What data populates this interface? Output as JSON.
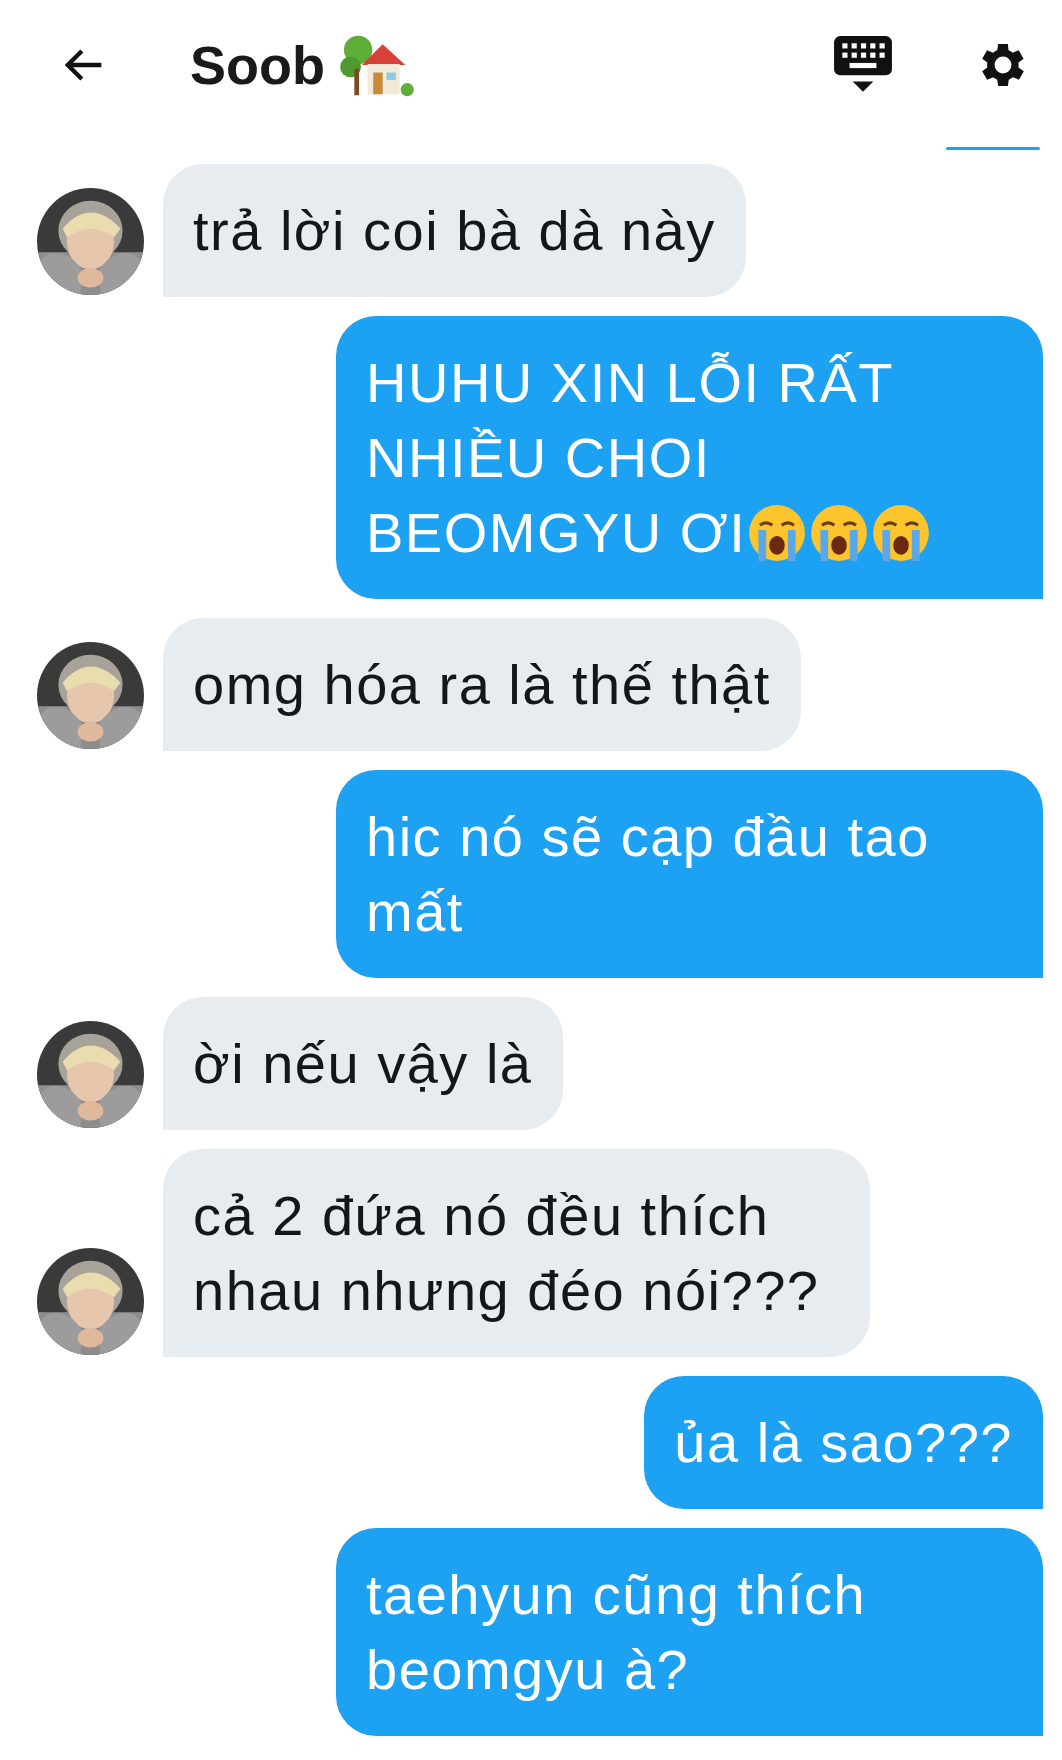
{
  "header": {
    "title": "Soob"
  },
  "messages": [
    {
      "sent": false,
      "kind": "text",
      "text": "trả lời coi bà dà này"
    },
    {
      "sent": true,
      "kind": "crying",
      "text": "HUHU XIN LỖI RẤT NHIỀU CHOI BEOMGYU ƠI"
    },
    {
      "sent": false,
      "kind": "text",
      "text": "omg hóa ra là thế thật"
    },
    {
      "sent": true,
      "kind": "text",
      "text": "hic nó sẽ cạp đầu tao mất"
    },
    {
      "sent": false,
      "kind": "text",
      "text": "ời nếu vậy là"
    },
    {
      "sent": false,
      "kind": "text",
      "text": "cả 2 đứa nó đều thích nhau nhưng đéo nói???"
    },
    {
      "sent": true,
      "kind": "text",
      "text": "ủa là sao???"
    },
    {
      "sent": true,
      "kind": "text",
      "text": "taehyun cũng thích beomgyu à?"
    }
  ]
}
